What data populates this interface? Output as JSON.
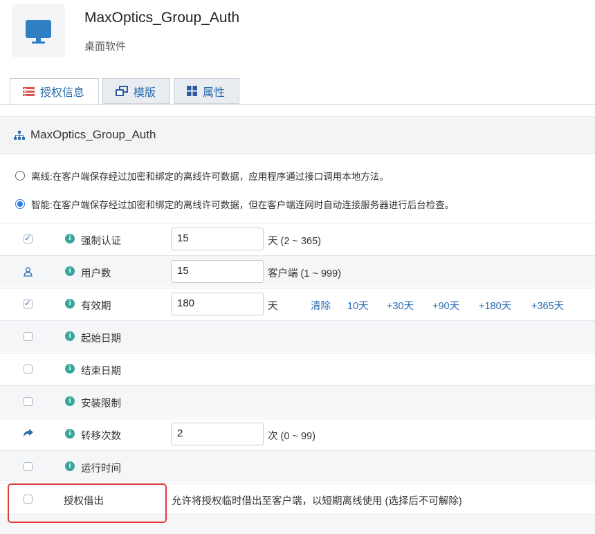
{
  "app": {
    "title": "MaxOptics_Group_Auth",
    "subtitle": "桌面软件",
    "icon": "desktop-monitor-icon"
  },
  "tabs": [
    {
      "label": "授权信息",
      "icon": "license-list-icon",
      "active": true
    },
    {
      "label": "模版",
      "icon": "template-icon",
      "active": false
    },
    {
      "label": "属性",
      "icon": "grid-icon",
      "active": false
    }
  ],
  "panel": {
    "title": "MaxOptics_Group_Auth",
    "icon": "sitemap-icon"
  },
  "modes": [
    {
      "label": "离线:在客户端保存经过加密和绑定的离线许可数据，应用程序通过接口调用本地方法。",
      "selected": false
    },
    {
      "label": "智能:在客户端保存经过加密和绑定的离线许可数据，但在客户端连网时自动连接服务器进行后台检查。",
      "selected": true
    }
  ],
  "options": [
    {
      "label": "强制认证",
      "control": "checkbox",
      "checked": true,
      "value": "15",
      "unit": "天 (2 ~ 365)"
    },
    {
      "label": "用户数",
      "control": "user-icon",
      "value": "15",
      "unit": "客户端 (1 ~ 999)"
    },
    {
      "label": "有效期",
      "control": "checkbox",
      "checked": true,
      "value": "180",
      "unit": "天",
      "quick_links": [
        "清除",
        "10天",
        "+30天",
        "+90天",
        "+180天",
        "+365天"
      ]
    },
    {
      "label": "起始日期",
      "control": "checkbox",
      "checked": false
    },
    {
      "label": "结束日期",
      "control": "checkbox",
      "checked": false
    },
    {
      "label": "安装限制",
      "control": "checkbox",
      "checked": false
    },
    {
      "label": "转移次数",
      "control": "share-arrow-icon",
      "value": "2",
      "unit": "次 (0 ~ 99)"
    },
    {
      "label": "运行时间",
      "control": "checkbox",
      "checked": false
    },
    {
      "label": "授权借出",
      "control": "checkbox",
      "checked": false,
      "description": "允许将授权临时借出至客户端，以短期离线使用 (选择后不可解除)",
      "highlighted": true
    }
  ],
  "colors": {
    "accent": "#2b6cb0",
    "info": "#3aa59b",
    "highlight_border": "#e53935"
  }
}
